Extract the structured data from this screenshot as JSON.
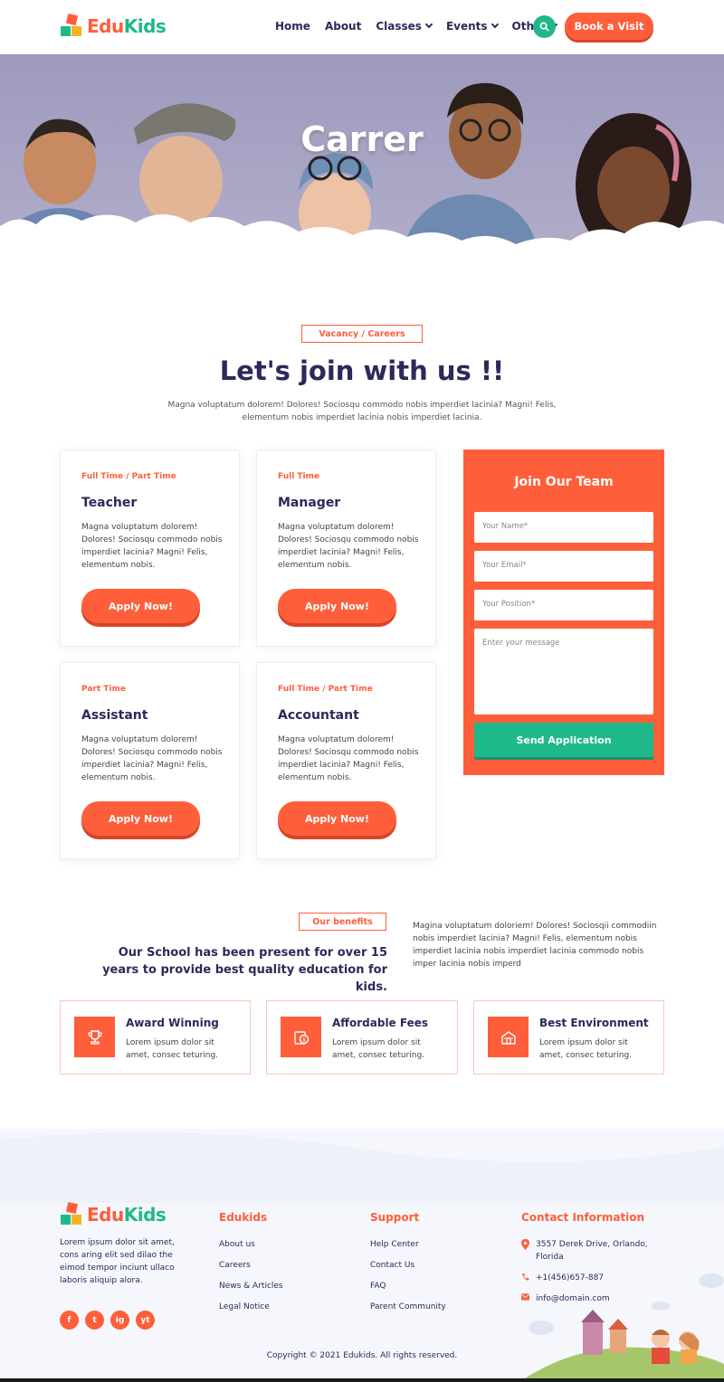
{
  "brand": {
    "part1": "Edu",
    "part2": "Kids"
  },
  "nav": {
    "items": [
      "Home",
      "About",
      "Classes",
      "Events",
      "Other"
    ],
    "book_label": "Book a Visit"
  },
  "hero": {
    "title": "Carrer"
  },
  "careers": {
    "tag": "Vacancy / Careers",
    "title": "Let's join with us !!",
    "description": "Magna voluptatum dolorem! Dolores! Sociosqu commodo nobis imperdiet lacinia? Magni! Felis, elementum nobis imperdiet lacinia nobis imperdiet lacinia.",
    "jobs": [
      {
        "type": "Full Time / Part Time",
        "role": "Teacher",
        "desc": "Magna voluptatum dolorem! Dolores! Sociosqu commodo nobis imperdiet lacinia? Magni! Felis, elementum nobis.",
        "apply": "Apply Now!"
      },
      {
        "type": "Full Time",
        "role": "Manager",
        "desc": "Magna voluptatum dolorem! Dolores! Sociosqu commodo nobis imperdiet lacinia? Magni! Felis, elementum nobis.",
        "apply": "Apply Now!"
      },
      {
        "type": "Part Time",
        "role": "Assistant",
        "desc": "Magna voluptatum dolorem! Dolores! Sociosqu commodo nobis imperdiet lacinia? Magni! Felis, elementum nobis.",
        "apply": "Apply Now!"
      },
      {
        "type": "Full Time / Part Time",
        "role": "Accountant",
        "desc": "Magna voluptatum dolorem! Dolores! Sociosqu commodo nobis imperdiet lacinia? Magni! Felis, elementum nobis.",
        "apply": "Apply Now!"
      }
    ],
    "form": {
      "title": "Join Our Team",
      "name_placeholder": "Your Name*",
      "email_placeholder": "Your Email*",
      "position_placeholder": "Your Position*",
      "message_placeholder": "Enter your message",
      "submit": "Send Application"
    }
  },
  "benefits": {
    "tag": "Our benefits",
    "title": "Our School has been present for over 15 years to provide best quality education for kids.",
    "description": "Magina voluptatum doloriem! Dolores! Sociosqii commodiin nobis imperdiet lacinia? Magni! Felis, elementum nobis imperdiet lacinia nobis imperdiet lacinia commodo nobis imper lacinia nobis imperd",
    "items": [
      {
        "title": "Award Winning",
        "desc": "Lorem ipsum dolor sit amet, consec teturing.",
        "icon": "trophy-icon"
      },
      {
        "title": "Affordable Fees",
        "desc": "Lorem ipsum dolor sit amet, consec teturing.",
        "icon": "money-icon"
      },
      {
        "title": "Best Environment",
        "desc": "Lorem ipsum dolor sit amet, consec teturing.",
        "icon": "school-icon"
      }
    ]
  },
  "footer": {
    "about": "Lorem ipsum dolor sit amet, cons aring elit sed dilao the eimod tempor inciunt ullaco laboris aliquip alora.",
    "socials": [
      "f",
      "t",
      "ig",
      "yt"
    ],
    "edukids": {
      "title": "Edukids",
      "links": [
        "About us",
        "Careers",
        "News & Articles",
        "Legal Notice"
      ]
    },
    "support": {
      "title": "Support",
      "links": [
        "Help Center",
        "Contact Us",
        "FAQ",
        "Parent Community"
      ]
    },
    "contact": {
      "title": "Contact Information",
      "address": "3557 Derek Drive, Orlando, Florida",
      "phone": "+1(456)657-887",
      "email": "info@domain.com"
    },
    "copyright": "Copyright © 2021 Edukids. All rights reserved."
  },
  "colors": {
    "accent": "#ff5e3a",
    "green": "#1fb88a",
    "navy": "#2a2a5a"
  }
}
